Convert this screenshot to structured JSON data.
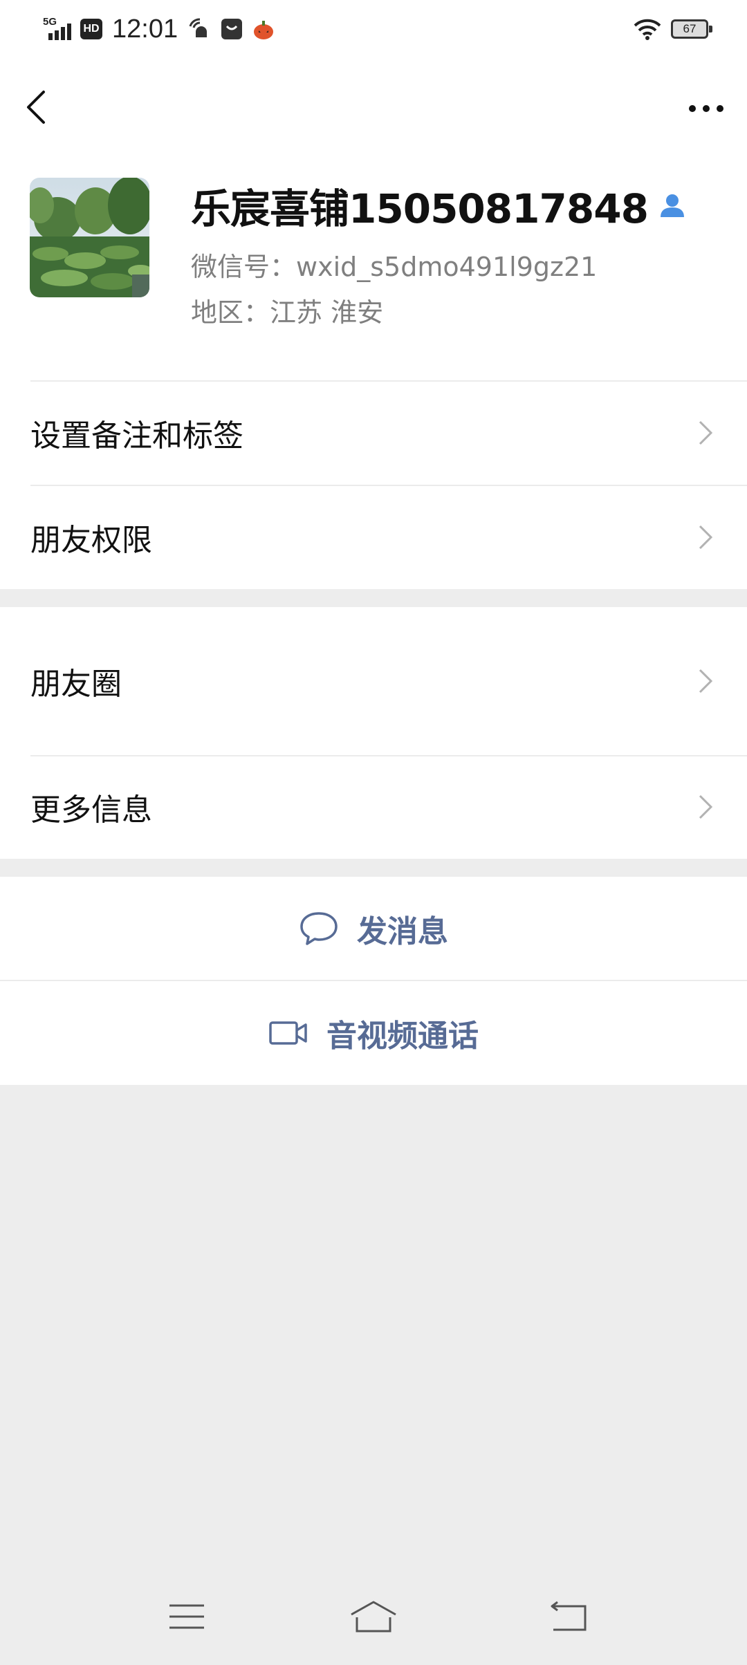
{
  "status_bar": {
    "network": "5G",
    "hd": "HD",
    "time": "12:01",
    "battery": "67"
  },
  "nav": {
    "back_icon": "chevron-left-icon",
    "more_icon": "more-dots-icon"
  },
  "profile": {
    "name": "乐宸喜铺15050817848",
    "wxid": "微信号：wxid_s5dmo491l9gz21",
    "region": "地区：江苏  淮安",
    "verified_icon": "contact-person-icon"
  },
  "list_group_1": [
    {
      "label": "设置备注和标签"
    },
    {
      "label": "朋友权限"
    }
  ],
  "list_group_2": [
    {
      "label": "朋友圈"
    },
    {
      "label": "更多信息"
    }
  ],
  "actions": {
    "message": "发消息",
    "call": "音视频通话"
  },
  "colors": {
    "link_blue": "#576b95",
    "background": "#ededed",
    "verified_blue": "#4a90e2"
  }
}
